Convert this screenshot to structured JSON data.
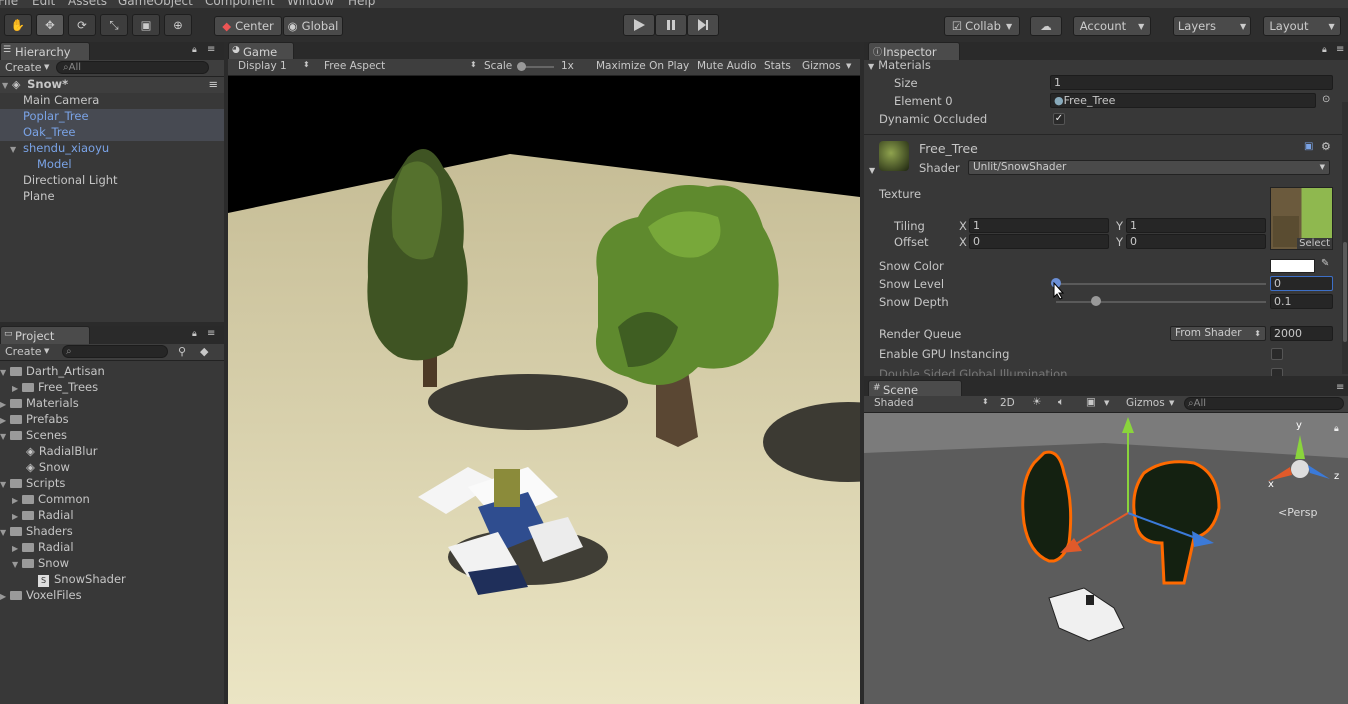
{
  "menu": [
    "File",
    "Edit",
    "Assets",
    "GameObject",
    "Component",
    "Window",
    "Help"
  ],
  "toolbar": {
    "center": "Center",
    "global": "Global",
    "collab": "Collab",
    "account": "Account",
    "layers": "Layers",
    "layout": "Layout"
  },
  "hierarchy": {
    "tab": "Hierarchy",
    "create": "Create",
    "search_placeholder": "All",
    "scene": "Snow*",
    "items": [
      "Main Camera",
      "Poplar_Tree",
      "Oak_Tree",
      "shendu_xiaoyu",
      "Model",
      "Directional Light",
      "Plane"
    ]
  },
  "project": {
    "tab": "Project",
    "create": "Create",
    "items": [
      "Darth_Artisan",
      "Free_Trees",
      "Materials",
      "Prefabs",
      "Scenes",
      "RadialBlur",
      "Snow",
      "Scripts",
      "Common",
      "Radial",
      "Shaders",
      "Radial",
      "Snow",
      "SnowShader",
      "VoxelFiles"
    ]
  },
  "game": {
    "tab": "Game",
    "display": "Display 1",
    "aspect": "Free Aspect",
    "scale_label": "Scale",
    "scale_value": "1x",
    "maximize": "Maximize On Play",
    "mute": "Mute Audio",
    "stats": "Stats",
    "gizmos": "Gizmos"
  },
  "inspector": {
    "tab": "Inspector",
    "materials": "Materials",
    "size_label": "Size",
    "size_value": "1",
    "element_label": "Element 0",
    "element_value": "Free_Tree",
    "dynamic_occluded": "Dynamic Occluded",
    "material_name": "Free_Tree",
    "shader_label": "Shader",
    "shader_value": "Unlit/SnowShader",
    "texture_label": "Texture",
    "tiling_label": "Tiling",
    "offset_label": "Offset",
    "x": "X",
    "y": "Y",
    "tiling_x": "1",
    "tiling_y": "1",
    "offset_x": "0",
    "offset_y": "0",
    "select": "Select",
    "snow_color": "Snow Color",
    "snow_level": "Snow Level",
    "snow_level_value": "0",
    "snow_depth": "Snow Depth",
    "snow_depth_value": "0.1",
    "render_queue": "Render Queue",
    "render_queue_mode": "From Shader",
    "render_queue_value": "2000",
    "gpu_instancing": "Enable GPU Instancing",
    "double_sided": "Double Sided Global Illumination"
  },
  "scene": {
    "tab": "Scene",
    "shaded": "Shaded",
    "mode2d": "2D",
    "gizmos": "Gizmos",
    "search_placeholder": "All",
    "persp": "Persp",
    "axis_x": "x",
    "axis_y": "y",
    "axis_z": "z"
  }
}
